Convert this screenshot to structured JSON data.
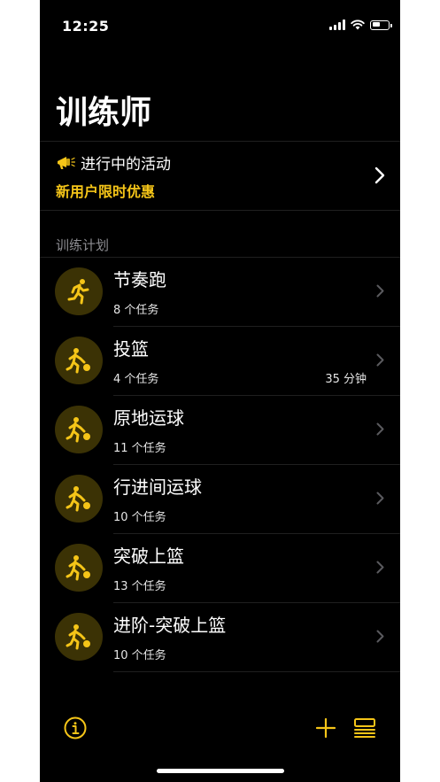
{
  "status_bar": {
    "time": "12:25"
  },
  "page": {
    "title": "训练师"
  },
  "activity": {
    "title": "进行中的活动",
    "subtitle": "新用户限时优惠",
    "icon": "megaphone-icon"
  },
  "section": {
    "header": "训练计划"
  },
  "plans": [
    {
      "name": "节奏跑",
      "count": "8 个任务",
      "duration": "",
      "icon": "runner-icon"
    },
    {
      "name": "投篮",
      "count": "4 个任务",
      "duration": "35 分钟",
      "icon": "basketball-player-icon"
    },
    {
      "name": "原地运球",
      "count": "11 个任务",
      "duration": "",
      "icon": "basketball-player-icon"
    },
    {
      "name": "行进间运球",
      "count": "10 个任务",
      "duration": "",
      "icon": "basketball-player-icon"
    },
    {
      "name": "突破上篮",
      "count": "13 个任务",
      "duration": "",
      "icon": "basketball-player-icon"
    },
    {
      "name": "进阶-突破上篮",
      "count": "10 个任务",
      "duration": "",
      "icon": "basketball-player-icon"
    }
  ],
  "colors": {
    "accent": "#f5c518",
    "avatar_bg": "#3b3205",
    "background": "#000000",
    "secondary_text": "#8e8e93"
  }
}
